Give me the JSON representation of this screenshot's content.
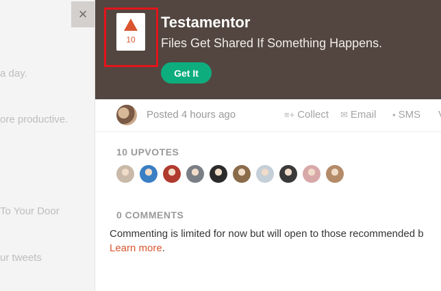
{
  "background": {
    "lines": [
      "a day.",
      "ore productive.",
      "To Your Door",
      "ur tweets"
    ]
  },
  "close_glyph": "×",
  "product": {
    "votes": "10",
    "name": "Testamentor",
    "tagline": "Files Get Shared If Something Happens.",
    "cta": "Get It"
  },
  "meta": {
    "posted": "Posted 4 hours ago",
    "actions": {
      "collect": "Collect",
      "email": "Email",
      "sms": "SMS",
      "more": "V"
    }
  },
  "upvotes": {
    "heading": "10 UPVOTES",
    "voter_colors": [
      "#c9b9a8",
      "#3a7fc4",
      "#b03a2e",
      "#7a7f86",
      "#2b2b2b",
      "#8a6b4a",
      "#c5cfd8",
      "#3a3a3a",
      "#d8a8a8",
      "#b48a68"
    ]
  },
  "comments": {
    "heading": "0 COMMENTS",
    "note": "Commenting is limited for now but will open to those recommended b",
    "learn_more": "Learn more",
    "period": "."
  },
  "colors": {
    "accent": "#da552f",
    "cta": "#0ead7e",
    "hero_bg": "#534640",
    "highlight": "#e5141b"
  }
}
